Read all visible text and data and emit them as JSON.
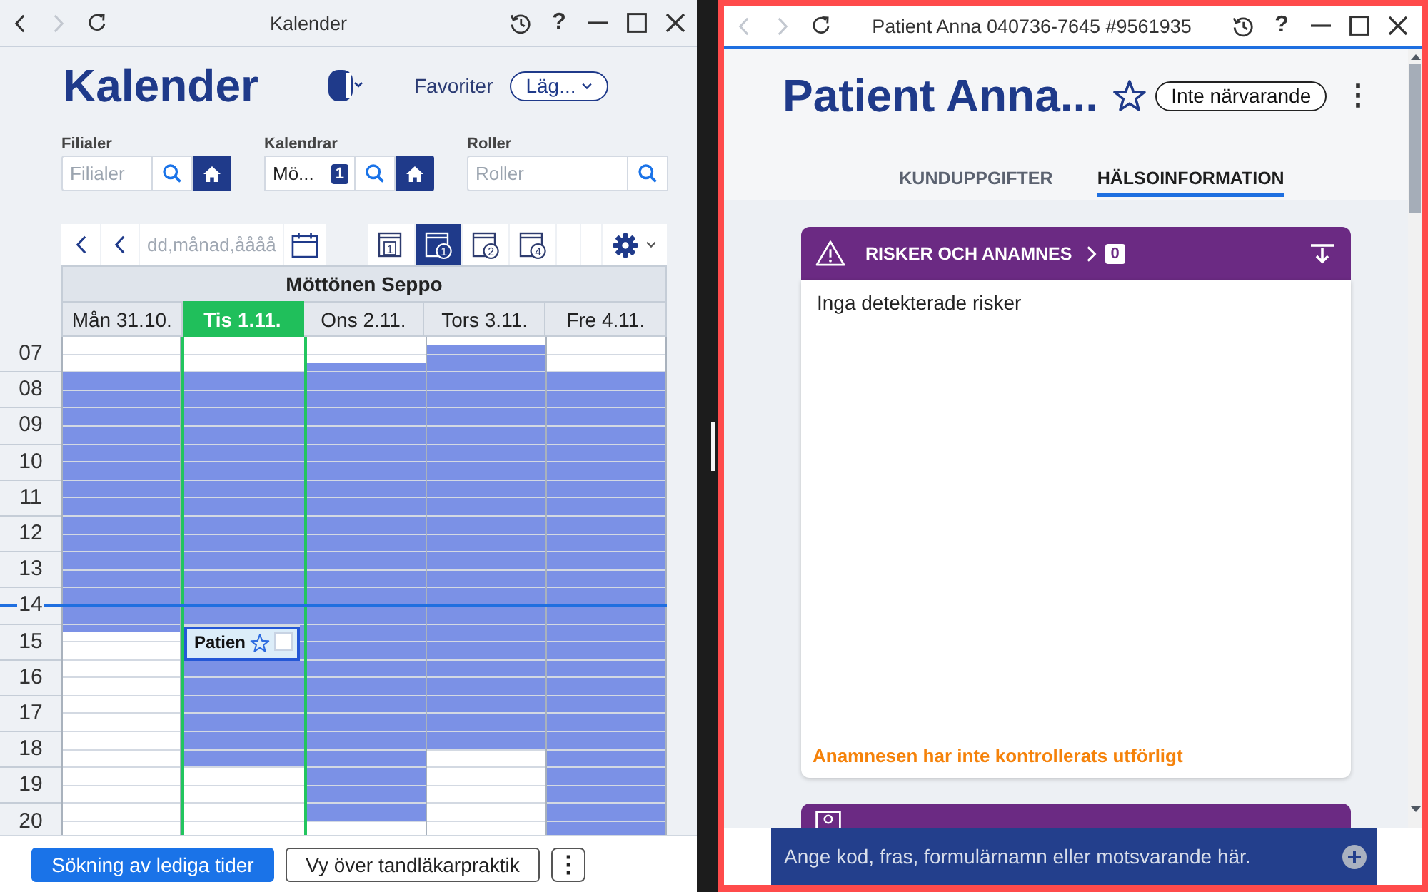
{
  "calendar_window": {
    "title": "Kalender",
    "back": {
      "disabled": false
    },
    "forward": {
      "disabled": true
    },
    "help": "?",
    "heading": "Kalender",
    "favorites": {
      "label": "Favoriter",
      "dropdown": "Läg..."
    },
    "filters": [
      {
        "label": "Filialer",
        "placeholder": "Filialer",
        "home": true
      },
      {
        "label": "Kalendrar",
        "value": "Mö...",
        "count": "1",
        "home": true
      },
      {
        "label": "Roller",
        "placeholder": "Roller",
        "home": false
      }
    ],
    "toolbar": {
      "date_placeholder": "dd,månad,åååå",
      "views": [
        {
          "kind": "plain",
          "number": "1",
          "selected": false
        },
        {
          "kind": "circled",
          "number": "1",
          "selected": true
        },
        {
          "kind": "circled",
          "number": "2",
          "selected": false
        },
        {
          "kind": "circled",
          "number": "4",
          "selected": false
        }
      ]
    },
    "resource": "Möttönen Seppo",
    "days": [
      {
        "label": "Mån 31.10.",
        "selected": false
      },
      {
        "label": "Tis 1.11.",
        "selected": true
      },
      {
        "label": "Ons 2.11.",
        "selected": false
      },
      {
        "label": "Tors 3.11.",
        "selected": false
      },
      {
        "label": "Fre 4.11.",
        "selected": false
      }
    ],
    "rows": [
      {
        "label": "07",
        "current_time": false,
        "cells": [
          {
            "busy": [
              false,
              false,
              false,
              false
            ]
          },
          {
            "busy": [
              false,
              false,
              false,
              false
            ]
          },
          {
            "busy": [
              false,
              false,
              false,
              true
            ]
          },
          {
            "busy": [
              false,
              true,
              true,
              true
            ]
          },
          {
            "busy": [
              false,
              false,
              false,
              false
            ]
          }
        ]
      },
      {
        "label": "08",
        "current_time": false,
        "cells": [
          {
            "busy": [
              true,
              true,
              true,
              true
            ]
          },
          {
            "busy": [
              true,
              true,
              true,
              true
            ]
          },
          {
            "busy": [
              true,
              true,
              true,
              true
            ]
          },
          {
            "busy": [
              true,
              true,
              true,
              true
            ]
          },
          {
            "busy": [
              true,
              true,
              true,
              true
            ]
          }
        ]
      },
      {
        "label": "09",
        "current_time": false,
        "cells": [
          {
            "busy": [
              true,
              true,
              true,
              true
            ]
          },
          {
            "busy": [
              true,
              true,
              true,
              true
            ]
          },
          {
            "busy": [
              true,
              true,
              true,
              true
            ]
          },
          {
            "busy": [
              true,
              true,
              true,
              true
            ]
          },
          {
            "busy": [
              true,
              true,
              true,
              true
            ]
          }
        ]
      },
      {
        "label": "10",
        "current_time": false,
        "cells": [
          {
            "busy": [
              true,
              true,
              true,
              true
            ]
          },
          {
            "busy": [
              true,
              true,
              true,
              true
            ]
          },
          {
            "busy": [
              true,
              true,
              true,
              true
            ]
          },
          {
            "busy": [
              true,
              true,
              true,
              true
            ]
          },
          {
            "busy": [
              true,
              true,
              true,
              true
            ]
          }
        ]
      },
      {
        "label": "11",
        "current_time": false,
        "cells": [
          {
            "busy": [
              true,
              true,
              true,
              true
            ]
          },
          {
            "busy": [
              true,
              true,
              true,
              true
            ]
          },
          {
            "busy": [
              true,
              true,
              true,
              true
            ]
          },
          {
            "busy": [
              true,
              true,
              true,
              true
            ]
          },
          {
            "busy": [
              true,
              true,
              true,
              true
            ]
          }
        ]
      },
      {
        "label": "12",
        "current_time": false,
        "cells": [
          {
            "busy": [
              true,
              true,
              true,
              true
            ]
          },
          {
            "busy": [
              true,
              true,
              true,
              true
            ]
          },
          {
            "busy": [
              true,
              true,
              true,
              true
            ]
          },
          {
            "busy": [
              true,
              true,
              true,
              true
            ]
          },
          {
            "busy": [
              true,
              true,
              true,
              true
            ]
          }
        ]
      },
      {
        "label": "13",
        "current_time": false,
        "cells": [
          {
            "busy": [
              true,
              true,
              true,
              true
            ]
          },
          {
            "busy": [
              true,
              true,
              true,
              true
            ]
          },
          {
            "busy": [
              true,
              true,
              true,
              true
            ]
          },
          {
            "busy": [
              true,
              true,
              true,
              true
            ]
          },
          {
            "busy": [
              true,
              true,
              true,
              true
            ]
          }
        ]
      },
      {
        "label": "14",
        "current_time": true,
        "cells": [
          {
            "busy": [
              true,
              true,
              true,
              true
            ]
          },
          {
            "busy": [
              true,
              true,
              true,
              true
            ]
          },
          {
            "busy": [
              true,
              true,
              true,
              true
            ]
          },
          {
            "busy": [
              true,
              true,
              true,
              true
            ]
          },
          {
            "busy": [
              true,
              true,
              true,
              true
            ]
          }
        ]
      },
      {
        "label": "15",
        "current_time": false,
        "cells": [
          {
            "busy": [
              true,
              false,
              false,
              false
            ]
          },
          {
            "busy": [
              true,
              true,
              true,
              true
            ],
            "appointment": {
              "title": "Patien",
              "checked": false
            }
          },
          {
            "busy": [
              true,
              true,
              true,
              true
            ]
          },
          {
            "busy": [
              true,
              true,
              true,
              true
            ]
          },
          {
            "busy": [
              true,
              true,
              true,
              true
            ]
          }
        ]
      },
      {
        "label": "16",
        "current_time": false,
        "cells": [
          {
            "busy": [
              false,
              false,
              false,
              false
            ]
          },
          {
            "busy": [
              true,
              true,
              true,
              true
            ]
          },
          {
            "busy": [
              true,
              true,
              true,
              true
            ]
          },
          {
            "busy": [
              true,
              true,
              true,
              true
            ]
          },
          {
            "busy": [
              true,
              true,
              true,
              true
            ]
          }
        ]
      },
      {
        "label": "17",
        "current_time": false,
        "cells": [
          {
            "busy": [
              false,
              false,
              false,
              false
            ]
          },
          {
            "busy": [
              true,
              true,
              true,
              true
            ]
          },
          {
            "busy": [
              true,
              true,
              true,
              true
            ]
          },
          {
            "busy": [
              true,
              true,
              true,
              true
            ]
          },
          {
            "busy": [
              true,
              true,
              true,
              true
            ]
          }
        ]
      },
      {
        "label": "18",
        "current_time": false,
        "cells": [
          {
            "busy": [
              false,
              false,
              false,
              false
            ]
          },
          {
            "busy": [
              true,
              true,
              true,
              true
            ]
          },
          {
            "busy": [
              true,
              true,
              true,
              true
            ]
          },
          {
            "busy": [
              true,
              true,
              false,
              false
            ]
          },
          {
            "busy": [
              true,
              true,
              true,
              true
            ]
          }
        ]
      },
      {
        "label": "19",
        "current_time": false,
        "cells": [
          {
            "busy": [
              false,
              false,
              false,
              false
            ]
          },
          {
            "busy": [
              false,
              false,
              false,
              false
            ]
          },
          {
            "busy": [
              true,
              true,
              true,
              true
            ]
          },
          {
            "busy": [
              false,
              false,
              false,
              false
            ]
          },
          {
            "busy": [
              true,
              true,
              true,
              true
            ]
          }
        ]
      },
      {
        "label": "20",
        "current_time": false,
        "cells": [
          {
            "busy": [
              false,
              false,
              false,
              false
            ]
          },
          {
            "busy": [
              false,
              false,
              false,
              false
            ]
          },
          {
            "busy": [
              true,
              true,
              false,
              false
            ]
          },
          {
            "busy": [
              false,
              false,
              false,
              false
            ]
          },
          {
            "busy": [
              true,
              true,
              true,
              true
            ]
          }
        ]
      }
    ],
    "buttons": [
      {
        "kind": "primary",
        "label": "Sökning av lediga tider"
      },
      {
        "kind": "secondary",
        "label": "Vy över tandläkarpraktik"
      },
      {
        "kind": "more",
        "label": "⋮"
      }
    ]
  },
  "patient_window": {
    "title": "Patient Anna 040736-7645 #9561935",
    "back": {
      "disabled": true
    },
    "forward": {
      "disabled": true
    },
    "help": "?",
    "heading": "Patient Anna...",
    "starred": false,
    "status": "Inte närvarande",
    "more": "⋮",
    "tabs": [
      {
        "label": "KUNDUPPGIFTER",
        "selected": false
      },
      {
        "label": "HÄLSOINFORMATION",
        "selected": true
      }
    ],
    "cards": [
      {
        "kind": "risks",
        "title": "RISKER OCH ANAMNES",
        "count": "0",
        "expanded": true,
        "body": "Inga detekterade risker",
        "notice": "Anamnesen har inte kontrollerats utförligt"
      },
      {
        "kind": "person"
      }
    ],
    "command": {
      "placeholder": "Ange kod, fras, formulärnamn eller motsvarande här."
    }
  }
}
